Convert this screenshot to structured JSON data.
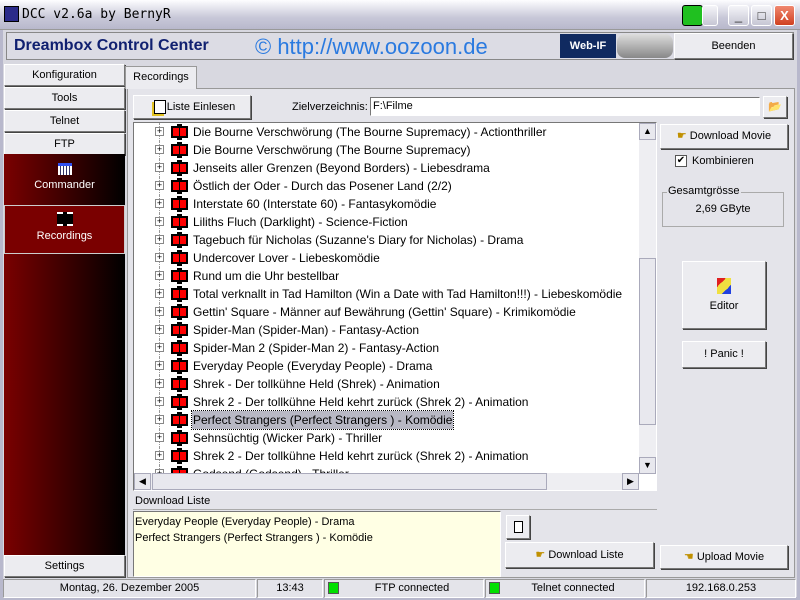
{
  "window": {
    "title": "DCC v2.6a by BernyR"
  },
  "header": {
    "app_name": "Dreambox Control Center",
    "website": "© http://www.oozoon.de",
    "logo_text": "Web-IF",
    "exit_button": "Beenden"
  },
  "sidebar": {
    "items": [
      {
        "label": "Konfiguration"
      },
      {
        "label": "Tools"
      },
      {
        "label": "Telnet"
      },
      {
        "label": "FTP"
      }
    ],
    "ftp_items": [
      {
        "label": "Commander",
        "icon": "grid-icon"
      },
      {
        "label": "Recordings",
        "icon": "film-icon",
        "selected": true
      }
    ],
    "settings": "Settings"
  },
  "tabs": [
    {
      "label": "Recordings",
      "active": true
    }
  ],
  "toolbar": {
    "read_list": "Liste Einlesen",
    "target_label": "Zielverzeichnis:",
    "target_value": "F:\\Filme"
  },
  "recordings": [
    "Die Bourne Verschwörung (The Bourne Supremacy) - Actionthriller",
    "Die Bourne Verschwörung (The Bourne Supremacy)",
    "Jenseits aller Grenzen (Beyond Borders) - Liebesdrama",
    "Östlich der Oder - Durch das Posener Land (2/2)",
    "Interstate 60 (Interstate 60) - Fantasykomödie",
    "Liliths Fluch (Darklight) - Science-Fiction",
    "Tagebuch für Nicholas (Suzanne's Diary for Nicholas) - Drama",
    "Undercover Lover - Liebeskomödie",
    "Rund um die Uhr bestellbar",
    "Total verknallt in Tad Hamilton (Win a Date with Tad Hamilton!!!) - Liebeskomödie",
    "Gettin' Square - Männer auf Bewährung (Gettin' Square) - Krimikomödie",
    "Spider-Man (Spider-Man) - Fantasy-Action",
    "Spider-Man 2 (Spider-Man 2) - Fantasy-Action",
    "Everyday People (Everyday People) - Drama",
    "Shrek - Der tollkühne Held (Shrek) - Animation",
    "Shrek 2 - Der tollkühne Held kehrt zurück (Shrek 2) - Animation",
    "Perfect Strangers (Perfect Strangers ) - Komödie",
    "Sehnsüchtig (Wicker Park) - Thriller",
    "Shrek 2 - Der tollkühne Held kehrt zurück (Shrek 2) - Animation",
    "Godsend (Godsend) - Thriller"
  ],
  "selected_recording": "Perfect Strangers (Perfect Strangers ) - Komödie",
  "download_list": {
    "title": "Download Liste",
    "items": [
      "Everyday People (Everyday People) - Drama",
      "Perfect Strangers (Perfect Strangers ) - Komödie"
    ],
    "button": "Download Liste"
  },
  "right_panel": {
    "download_movie": "Download Movie",
    "combine_label": "Kombinieren",
    "combine_checked": true,
    "total_size_label": "Gesamtgrösse",
    "total_size": "2,69 GByte",
    "editor": "Editor",
    "panic": "! Panic !",
    "upload_movie": "Upload Movie"
  },
  "statusbar": {
    "date": "Montag, 26. Dezember 2005",
    "time": "13:43",
    "ftp": "FTP connected",
    "telnet": "Telnet connected",
    "ip": "192.168.0.253",
    "led_color": "#00e000"
  }
}
